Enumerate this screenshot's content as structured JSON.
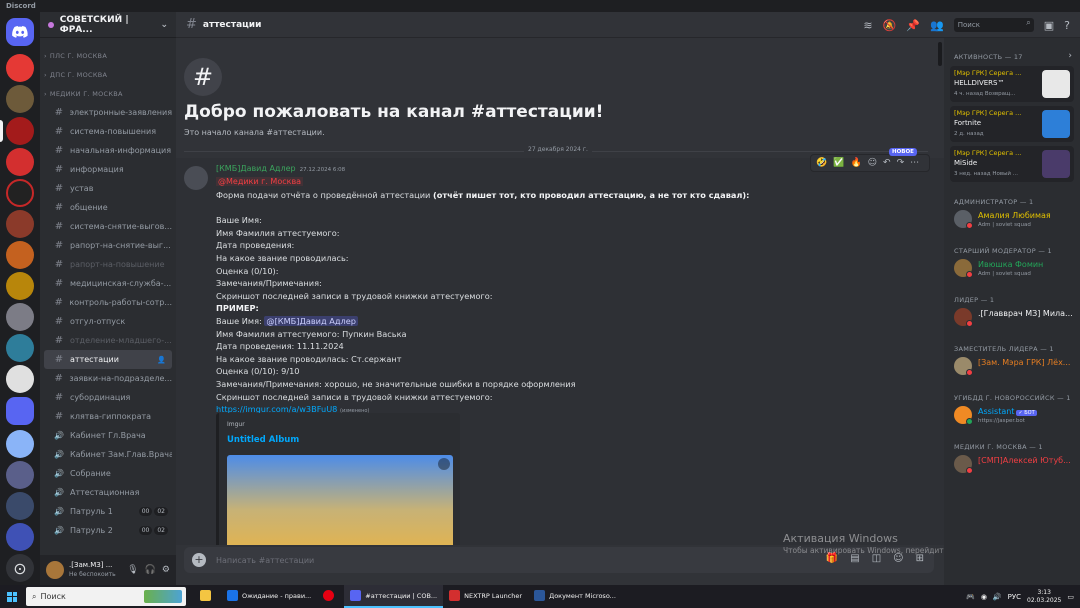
{
  "window": {
    "app_name": "Discord"
  },
  "server": {
    "name": "СОВЕТСКИЙ | ФРА..."
  },
  "channels": [
    {
      "type": "category",
      "label": "ПЛС Г. МОСКВА"
    },
    {
      "type": "category",
      "label": "ДПС Г. МОСКВА"
    },
    {
      "type": "category",
      "label": "МЕДИКИ Г. МОСКВА"
    },
    {
      "type": "text",
      "label": "электронные-заявления"
    },
    {
      "type": "text",
      "label": "система-повышения"
    },
    {
      "type": "text",
      "label": "начальная-информация"
    },
    {
      "type": "text",
      "label": "информация"
    },
    {
      "type": "text",
      "label": "устав"
    },
    {
      "type": "text",
      "label": "общение"
    },
    {
      "type": "text",
      "label": "система-снятие-выгов..."
    },
    {
      "type": "text",
      "label": "рапорт-на-снятие-выг..."
    },
    {
      "type": "text",
      "label": "рапорт-на-повышение",
      "muted": true
    },
    {
      "type": "text",
      "label": "медицинская-служба-..."
    },
    {
      "type": "text",
      "label": "контроль-работы-сотр..."
    },
    {
      "type": "text",
      "label": "отгул-отпуск"
    },
    {
      "type": "text",
      "label": "отделение-младшего-...",
      "muted": true
    },
    {
      "type": "text",
      "label": "аттестации",
      "active": true
    },
    {
      "type": "text",
      "label": "заявки-на-подразделе..."
    },
    {
      "type": "text",
      "label": "субординация"
    },
    {
      "type": "text",
      "label": "клятва-гиппократа"
    },
    {
      "type": "voice",
      "label": "Кабинет Гл.Врача"
    },
    {
      "type": "voice",
      "label": "Кабинет Зам.Глав.Врача"
    },
    {
      "type": "voice",
      "label": "Собрание"
    },
    {
      "type": "voice",
      "label": "Аттестационная"
    },
    {
      "type": "voice",
      "label": "Патруль 1",
      "counts": [
        "00",
        "02"
      ]
    },
    {
      "type": "voice",
      "label": "Патруль 2",
      "counts": [
        "00",
        "02"
      ]
    }
  ],
  "user_panel": {
    "name": ".[Зам.МЗ] ...",
    "status": "Не беспокоить"
  },
  "topbar": {
    "channel": "аттестации",
    "search_placeholder": "Поиск"
  },
  "welcome": {
    "title": "Добро пожаловать на канал #аттестации!",
    "subtitle": "Это начало канала #аттестации."
  },
  "date_divider": "27 декабря 2024 г.",
  "message": {
    "author": "[КМБ]Давид Адлер",
    "timestamp": "27.12.2024 6:08",
    "role_mention": "@Медики г. Москва",
    "intro": "Форма подачи отчёта о проведённой аттестации",
    "intro_bold": "(отчёт пишет тот, кто проводил аттестацию, а не тот кто сдавал):",
    "template_lines": [
      "Ваше Имя:",
      "Имя Фамилия аттестуемого:",
      "Дата проведения:",
      "На какое звание проводилась:",
      "Оценка (0/10):",
      "Замечания/Примечания:",
      "Скриншот последней записи в трудовой книжки аттестуемого:"
    ],
    "example_header": "ПРИМЕР:",
    "example_name_label": "Ваше Имя:",
    "example_name_mention": "@[КМБ]Давид Адлер",
    "example_lines": [
      "Имя Фамилия аттестуемого: Пупкин Васька",
      "Дата проведения: 11.11.2024",
      "На какое звание проводилась: Ст.сержант",
      "Оценка (0/10): 9/10",
      "Замечания/Примечания: хорошо, не значительные ошибки в порядке оформления",
      "Скриншот последней записи в трудовой книжки аттестуемого:"
    ],
    "link": "https://imgur.com/a/w3BFuU8",
    "edited": "(изменено)",
    "reactions": [
      "🤣",
      "✅",
      "🔥"
    ],
    "new_badge": "НОВОЕ"
  },
  "embed": {
    "provider": "Imgur",
    "title": "Untitled Album"
  },
  "composer": {
    "placeholder": "Написать #аттестации"
  },
  "activation": {
    "title": "Активация Windows",
    "text": "Чтобы активировать Windows, перейдите в раздел \"Параметры\"."
  },
  "members": {
    "activity_header": "АКТИВНОСТЬ — 17",
    "activity_cards": [
      {
        "name": "[Мэр ГРК] Серега ...",
        "game": "HELLDIVERS™",
        "meta": "4 ч. назад",
        "meta2": "Возвращ..."
      },
      {
        "name": "[Мэр ГРК] Серега ...",
        "game": "Fortnite",
        "meta": "2 д. назад",
        "meta2": ""
      },
      {
        "name": "[Мэр ГРК] Серега ...",
        "game": "MiSide",
        "meta": "3 нед. назад",
        "meta2": "Новый ..."
      }
    ],
    "groups": [
      {
        "header": "АДМИНИСТРАТОР — 1",
        "name": "Амалия Любимая",
        "sub": "Adm | soviet squad",
        "color": "#e2c100"
      },
      {
        "header": "СТАРШИЙ МОДЕРАТОР — 1",
        "name": "Ивюшка Фомин",
        "sub": "Adm | soviet squad",
        "color": "#23a559"
      },
      {
        "header": "ЛИДЕР — 1",
        "name": ".[Главврач МЗ] Мила...",
        "sub": "",
        "color": "#f2f3f5"
      },
      {
        "header": "ЗАМЕСТИТЕЛЬ ЛИДЕРА — 1",
        "name": "[Зам. Мэра ГРК] Лёх...",
        "sub": "",
        "color": "#e67e22"
      },
      {
        "header": "УГИБДД Г. НОВОРОССИЙСК — 1",
        "name": "Assistant",
        "bot": "✓ БОТ",
        "sub": "https://jasper.bot",
        "color": "#00a8fc"
      },
      {
        "header": "МЕДИКИ Г. МОСКВА — 1",
        "name": "[СМП]Алексей Ютуб...",
        "sub": "",
        "color": "#f23f43"
      }
    ]
  },
  "taskbar": {
    "search": "Поиск",
    "apps": [
      {
        "label": "Ожидание - прави...",
        "color": "#1a73e8"
      },
      {
        "label": "",
        "color": "#e60012"
      },
      {
        "label": "#аттестации | СОВ...",
        "color": "#5865f2",
        "active": true
      },
      {
        "label": "NEXTRP Launcher",
        "color": "#d32f2f"
      },
      {
        "label": "Документ Microso...",
        "color": "#2b579a"
      }
    ],
    "lang": "РУС",
    "time": "3:13",
    "date": "02.03.2025"
  },
  "colors": {
    "accent": "#5865f2",
    "background": "#313338",
    "sidebar": "#2b2d31"
  }
}
